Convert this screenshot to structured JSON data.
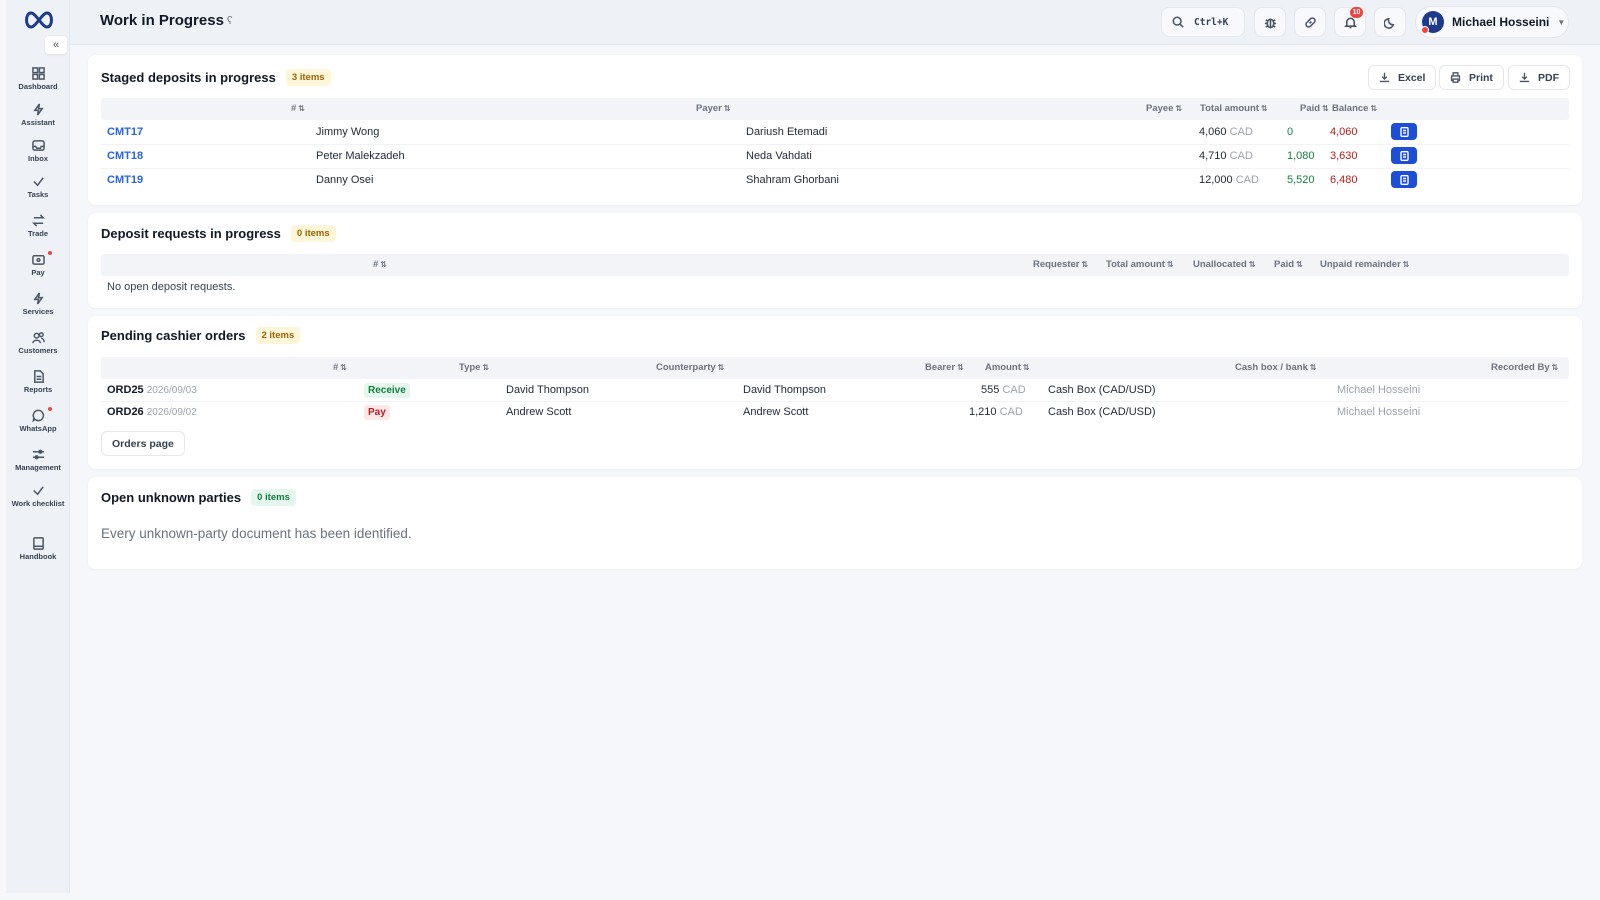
{
  "page": {
    "title": "Work in Progress",
    "title_icon": "ʕ"
  },
  "sidebar": {
    "collapse_glyph": "«",
    "items": [
      {
        "label": "Dashboard",
        "icon": "dashboard-icon"
      },
      {
        "label": "Assistant",
        "icon": "bolt-icon"
      },
      {
        "label": "Inbox",
        "icon": "inbox-icon"
      },
      {
        "label": "Tasks",
        "icon": "check-icon"
      },
      {
        "label": "Trade",
        "icon": "swap-icon"
      },
      {
        "label": "Pay",
        "icon": "wallet-icon"
      },
      {
        "label": "Services",
        "icon": "bolt-icon"
      },
      {
        "label": "Customers",
        "icon": "users-icon"
      },
      {
        "label": "Reports",
        "icon": "report-icon"
      },
      {
        "label": "WhatsApp",
        "icon": "chat-icon"
      },
      {
        "label": "Management",
        "icon": "sliders-icon"
      },
      {
        "label": "Work checklist",
        "icon": "check-icon"
      },
      {
        "label": "Handbook",
        "icon": "book-icon"
      }
    ]
  },
  "topbar": {
    "search_shortcut": "Ctrl+K",
    "notifications_count": "10",
    "user": {
      "initial": "M",
      "name": "Michael Hosseini"
    }
  },
  "staged": {
    "title": "Staged deposits in progress",
    "badge": "3 items",
    "exports": {
      "excel": "Excel",
      "print": "Print",
      "pdf": "PDF"
    },
    "columns": {
      "num": "#",
      "payer": "Payer",
      "payee": "Payee",
      "total": "Total amount",
      "paid": "Paid",
      "balance": "Balance"
    },
    "sort_glyph": "⇅",
    "rows": [
      {
        "id": "CMT17",
        "payer": "Jimmy Wong",
        "payee": "Dariush Etemadi",
        "total": "4,060",
        "currency": "CAD",
        "paid": "0",
        "balance": "4,060"
      },
      {
        "id": "CMT18",
        "payer": "Peter Malekzadeh",
        "payee": "Neda Vahdati",
        "total": "4,710",
        "currency": "CAD",
        "paid": "1,080",
        "balance": "3,630"
      },
      {
        "id": "CMT19",
        "payer": "Danny Osei",
        "payee": "Shahram Ghorbani",
        "total": "12,000",
        "currency": "CAD",
        "paid": "5,520",
        "balance": "6,480"
      }
    ]
  },
  "requests": {
    "title": "Deposit requests in progress",
    "badge": "0 items",
    "columns": {
      "num": "#",
      "requester": "Requester",
      "total": "Total amount",
      "unallocated": "Unallocated",
      "paid": "Paid",
      "unpaid": "Unpaid remainder"
    },
    "empty": "No open deposit requests."
  },
  "cashier": {
    "title": "Pending cashier orders",
    "badge": "2 items",
    "columns": {
      "num": "#",
      "type": "Type",
      "counterparty": "Counterparty",
      "bearer": "Bearer",
      "amount": "Amount",
      "cashbox": "Cash box / bank",
      "recorded": "Recorded By"
    },
    "rows": [
      {
        "id": "ORD25",
        "date": "2026/09/03",
        "type": "Receive",
        "counterparty": "David Thompson",
        "bearer": "David Thompson",
        "amount": "555",
        "currency": "CAD",
        "cashbox": "Cash Box (CAD/USD)",
        "recorded": "Michael Hosseini"
      },
      {
        "id": "ORD26",
        "date": "2026/09/02",
        "type": "Pay",
        "counterparty": "Andrew Scott",
        "bearer": "Andrew Scott",
        "amount": "1,210",
        "currency": "CAD",
        "cashbox": "Cash Box (CAD/USD)",
        "recorded": "Michael Hosseini"
      }
    ],
    "orders_button": "Orders page"
  },
  "unknown": {
    "title": "Open unknown parties",
    "badge": "0 items",
    "empty": "Every unknown-party document has been identified."
  }
}
